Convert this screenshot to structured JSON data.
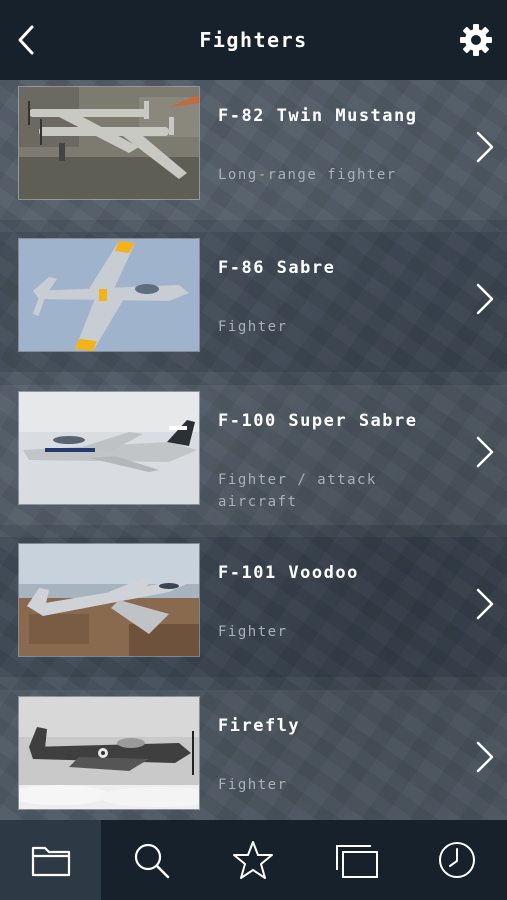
{
  "header": {
    "title": "Fighters",
    "back_icon": "chevron-left-icon",
    "settings_icon": "gear-icon"
  },
  "items": [
    {
      "name": "F-82 Twin Mustang",
      "role": "Long-range fighter"
    },
    {
      "name": "F-86 Sabre",
      "role": "Fighter"
    },
    {
      "name": "F-100 Super Sabre",
      "role": "Fighter / attack aircraft"
    },
    {
      "name": "F-101 Voodoo",
      "role": "Fighter"
    },
    {
      "name": "Firefly",
      "role": "Fighter"
    }
  ],
  "tabbar": {
    "tabs": [
      {
        "icon": "folder-icon",
        "active": true
      },
      {
        "icon": "search-icon",
        "active": false
      },
      {
        "icon": "star-icon",
        "active": false
      },
      {
        "icon": "gallery-icon",
        "active": false
      },
      {
        "icon": "history-icon",
        "active": false
      }
    ]
  },
  "colors": {
    "header_bg": "#17212b",
    "tabbar_bg": "#17212b",
    "active_tab_bg": "#2d3a46",
    "text_primary": "#ffffff",
    "text_secondary": "#a9b2ba"
  }
}
